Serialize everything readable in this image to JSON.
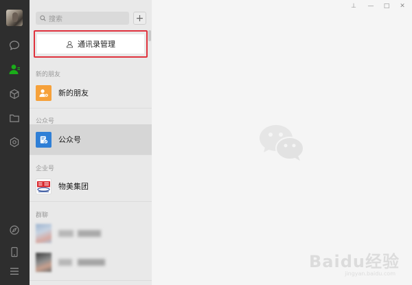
{
  "search": {
    "placeholder": "搜索"
  },
  "contacts_manage": {
    "label": "通讯录管理"
  },
  "sections": {
    "new_friends": "新的朋友",
    "official": "公众号",
    "enterprise": "企业号",
    "groups": "群聊"
  },
  "items": {
    "new_friends": "新的朋友",
    "official": "公众号",
    "enterprise": "物美集团"
  },
  "window_controls": {
    "pin": "⊥",
    "minimize": "—",
    "maximize": "□",
    "close": "✕"
  },
  "watermark": {
    "main": "Baidu经验",
    "sub": "jingyan.baidu.com"
  },
  "colors": {
    "nav_bg": "#2e2e2e",
    "active_green": "#1aad19",
    "highlight_red": "#e0323d",
    "new_friend_orange": "#f6a13a",
    "official_blue": "#2f7fd6",
    "wumart_red": "#d8232a"
  }
}
